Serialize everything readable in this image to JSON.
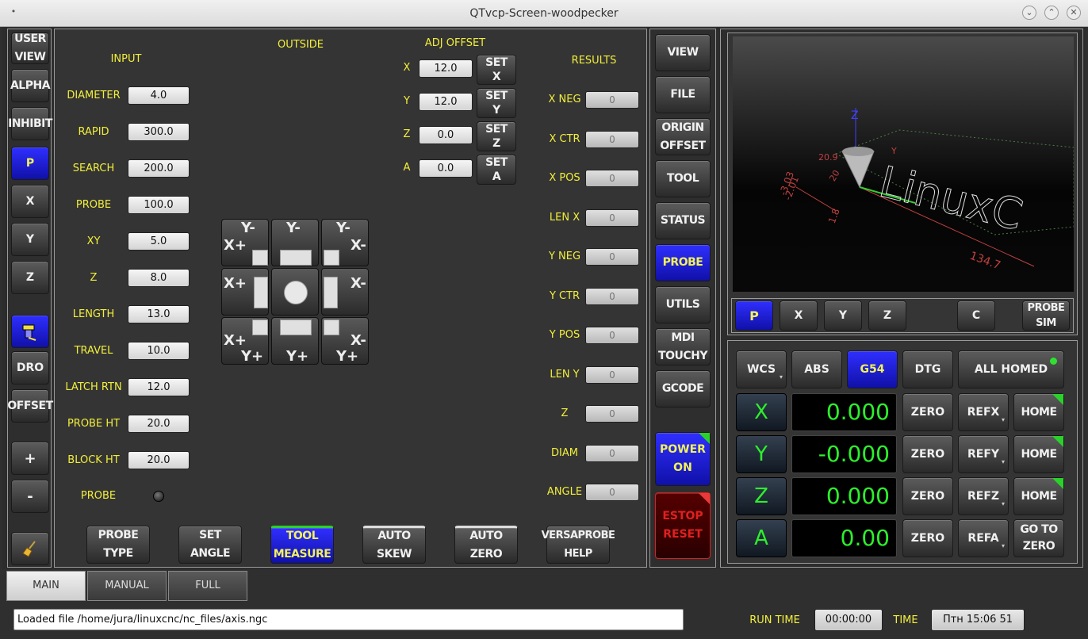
{
  "window": {
    "title": "QTvcp-Screen-woodpecker",
    "btn_min": "⌄",
    "btn_max": "⌃",
    "btn_close": "✕"
  },
  "left_bar": {
    "user_view": "USER\nVIEW",
    "alpha": "ALPHA",
    "inhibit": "INHIBIT",
    "p": "P",
    "x": "X",
    "y": "Y",
    "z": "Z",
    "dro": "DRO",
    "offset": "OFFSET",
    "plus": "+",
    "minus": "-"
  },
  "probe": {
    "input_title": "INPUT",
    "outside_title": "OUTSIDE",
    "adj_title": "ADJ OFFSET",
    "results_title": "RESULTS",
    "inputs": [
      {
        "label": "DIAMETER",
        "value": "4.0"
      },
      {
        "label": "RAPID",
        "value": "300.0"
      },
      {
        "label": "SEARCH",
        "value": "200.0"
      },
      {
        "label": "PROBE",
        "value": "100.0"
      },
      {
        "label": "XY",
        "value": "5.0"
      },
      {
        "label": "Z",
        "value": "8.0"
      },
      {
        "label": "LENGTH",
        "value": "13.0"
      },
      {
        "label": "TRAVEL",
        "value": "10.0"
      },
      {
        "label": "LATCH RTN",
        "value": "12.0"
      },
      {
        "label": "PROBE HT",
        "value": "20.0"
      },
      {
        "label": "BLOCK HT",
        "value": "20.0"
      }
    ],
    "probe_led_label": "PROBE",
    "adj": [
      {
        "axis": "X",
        "value": "12.0",
        "btn": "SET\nX"
      },
      {
        "axis": "Y",
        "value": "12.0",
        "btn": "SET\nY"
      },
      {
        "axis": "Z",
        "value": "0.0",
        "btn": "SET\nZ"
      },
      {
        "axis": "A",
        "value": "0.0",
        "btn": "SET\nA"
      }
    ],
    "results": [
      {
        "label": "X NEG",
        "value": "0"
      },
      {
        "label": "X CTR",
        "value": "0"
      },
      {
        "label": "X POS",
        "value": "0"
      },
      {
        "label": "LEN X",
        "value": "0"
      },
      {
        "label": "Y NEG",
        "value": "0"
      },
      {
        "label": "Y CTR",
        "value": "0"
      },
      {
        "label": "Y POS",
        "value": "0"
      },
      {
        "label": "LEN Y",
        "value": "0"
      },
      {
        "label": "Z",
        "value": "0"
      },
      {
        "label": "DIAM",
        "value": "0"
      },
      {
        "label": "ANGLE",
        "value": "0"
      }
    ],
    "grid": {
      "ym": "Y-",
      "yp": "Y+",
      "xp": "X+",
      "xm": "X-"
    },
    "bottom_btns": [
      "PROBE TYPE",
      "SET\nANGLE",
      "TOOL\nMEASURE",
      "AUTO\nSKEW",
      "AUTO\nZERO",
      "VERSAPROBE\nHELP"
    ]
  },
  "side_nav": [
    "VIEW",
    "FILE",
    "ORIGIN\nOFFSET",
    "TOOL",
    "STATUS",
    "PROBE",
    "UTILS",
    "MDI\nTOUCHY",
    "GCODE"
  ],
  "power": "POWER\nON",
  "estop": "ESTOP\nRESET",
  "preview": {
    "buttons": [
      "P",
      "X",
      "Y",
      "Z",
      "C",
      "PROBE\nSIM"
    ],
    "overlay": [
      "Z",
      "Y",
      "20.9",
      "-3.03",
      "-2.01",
      "1.8",
      "134.7",
      "20",
      "LinuxC"
    ]
  },
  "dro": {
    "wcs": "WCS",
    "abs": "ABS",
    "g54": "G54",
    "dtg": "DTG",
    "all_homed": "ALL HOMED",
    "rows": [
      {
        "axis": "X",
        "value": "0.000",
        "zero": "ZERO",
        "ref": "REFX",
        "home": "HOME"
      },
      {
        "axis": "Y",
        "value": "-0.000",
        "zero": "ZERO",
        "ref": "REFY",
        "home": "HOME"
      },
      {
        "axis": "Z",
        "value": "0.000",
        "zero": "ZERO",
        "ref": "REFZ",
        "home": "HOME"
      },
      {
        "axis": "A",
        "value": "0.00",
        "zero": "ZERO",
        "ref": "REFA",
        "home": "GO TO\nZERO"
      }
    ]
  },
  "tabs": [
    "MAIN",
    "MANUAL",
    "FULL"
  ],
  "status": {
    "message": "Loaded file /home/jura/linuxcnc/nc_files/axis.ngc",
    "run_time_label": "RUN TIME",
    "run_time": "00:00:00",
    "time_label": "TIME",
    "time": "Птн 15:06 51"
  }
}
